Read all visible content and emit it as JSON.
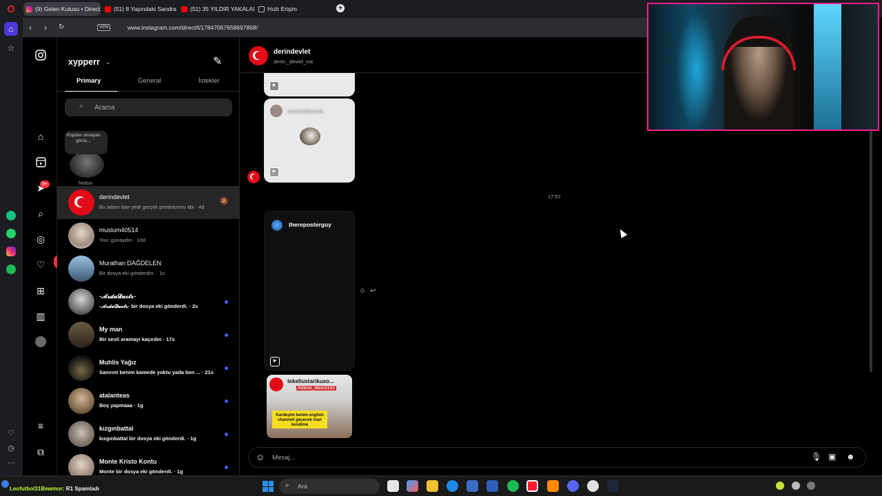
{
  "browser": {
    "tabs": [
      {
        "label": "(9) Gelen Kutusu • Direct",
        "icon": "instagram-icon"
      },
      {
        "label": "(51) 8 Yaşındaki Sandra Ca",
        "icon": "youtube-icon"
      },
      {
        "label": "(51) 35 YILDIR YAKALANA",
        "icon": "youtube-icon"
      },
      {
        "label": "Hızlı Erişim",
        "icon": "grid-icon"
      }
    ],
    "vpn_label": "VPN",
    "url": "www.instagram.com/direct/t/17847067658697858/"
  },
  "inbox": {
    "username": "xypperr",
    "tabs": [
      "Primary",
      "General",
      "İstekler"
    ],
    "search_placeholder": "Arama",
    "note_bubble": "Popüler olmayan görüş...",
    "note_label": "Notun",
    "notifications_badge": "9+",
    "likes_popup": "1",
    "threads": [
      {
        "name": "derindevlet",
        "message": "Bu adam ban yedi gerçek predotormu abi · 4d",
        "selected": true,
        "unread": false,
        "muted": true
      },
      {
        "name": "muslum40514",
        "message": "You: günaydın · 10d",
        "selected": false,
        "unread": false,
        "muted": false
      },
      {
        "name": "Murathan DAĞDELEN",
        "message": "Bir dosya eki gönderdin. · 1s",
        "selected": false,
        "unread": false,
        "muted": false
      },
      {
        "name": "-𝓐𝓻𝓭𝓪𝓓𝓪𝓬𝓽𝓻-",
        "message": "-𝓐𝓻𝓭𝓪𝓓𝓪𝓬𝓽𝓻- bir dosya eki gönderdi. · 2s",
        "selected": false,
        "unread": true,
        "muted": false
      },
      {
        "name": "My man",
        "message": "Bir sesli aramayı kaçırdın · 17s",
        "selected": false,
        "unread": true,
        "muted": false
      },
      {
        "name": "Muhlis Yağız",
        "message": "Sanırım benim kamede yoktu yada ben ... · 21s",
        "selected": false,
        "unread": true,
        "muted": false
      },
      {
        "name": "atalanteas",
        "message": "Boş yapmaaa · 1g",
        "selected": false,
        "unread": true,
        "muted": false
      },
      {
        "name": "kızgınbattal",
        "message": "kızgınbattal bir dosya eki gönderdi. · 1g",
        "selected": false,
        "unread": true,
        "muted": false
      },
      {
        "name": "Monte Kristo Kontu",
        "message": "Monte bir dosya eki gönderdi. · 1g",
        "selected": false,
        "unread": true,
        "muted": false
      }
    ]
  },
  "chat": {
    "name": "derindevlet",
    "subtitle": "derin._devlet_mit",
    "card_user": "nazanlubiryanik",
    "timestamp": "17:57",
    "shared_user": "thereposterguy",
    "thumb_title": "tekeliustarikuso...",
    "thumb_sub": "Adana_abisi3162",
    "thumb_caption": "Kardeşim benim english channeli geçecek inan kendime",
    "composer_placeholder": "Mesaj..."
  },
  "taskbar": {
    "search_placeholder": "Ara"
  },
  "stream_overlay": {
    "user": "Leofutbol31Bewmor",
    "text": ": R1 Spamladı"
  }
}
